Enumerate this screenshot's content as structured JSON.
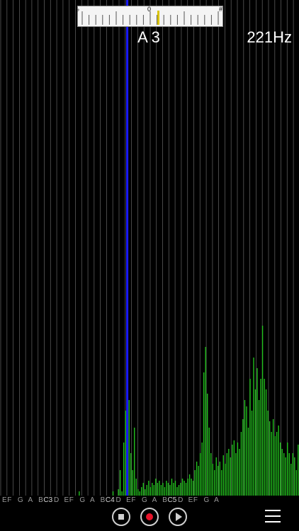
{
  "tuner": {
    "flat_symbol": "♭",
    "zero_label": "0",
    "sharp_symbol": "#",
    "needle_cents": 6,
    "needle_color": "#d9c300",
    "tick_count": 21
  },
  "reading": {
    "note": "A 3",
    "frequency": "221Hz"
  },
  "spectrum": {
    "bar_color": "#22c21d",
    "marker_color": "#1a1aff",
    "grid_color": "#5a5a5a",
    "bin_count": 168,
    "marker_bin": 71,
    "levels": [
      0.0,
      0.0,
      0.0,
      0.0,
      0.0,
      0.0,
      0.0,
      0.0,
      0.0,
      0.0,
      0.0,
      0.0,
      0.0,
      0.0,
      0.0,
      0.0,
      0.0,
      0.0,
      0.0,
      0.0,
      0.0,
      0.0,
      0.0,
      0.0,
      0.0,
      0.0,
      0.0,
      0.0,
      0.0,
      0.0,
      0.0,
      0.0,
      0.0,
      0.0,
      0.0,
      0.0,
      0.0,
      0.0,
      0.0,
      0.0,
      0.0,
      0.0,
      0.0,
      0.0,
      0.02,
      0.0,
      0.0,
      0.0,
      0.0,
      0.0,
      0.0,
      0.0,
      0.0,
      0.0,
      0.0,
      0.0,
      0.0,
      0.0,
      0.0,
      0.0,
      0.0,
      0.0,
      0.0,
      0.02,
      0.0,
      0.0,
      0.03,
      0.12,
      0.02,
      0.25,
      0.4,
      0.5,
      0.45,
      0.2,
      0.12,
      0.32,
      0.08,
      0.03,
      0.02,
      0.04,
      0.06,
      0.03,
      0.05,
      0.07,
      0.04,
      0.06,
      0.05,
      0.08,
      0.06,
      0.07,
      0.05,
      0.06,
      0.04,
      0.07,
      0.06,
      0.05,
      0.08,
      0.06,
      0.07,
      0.04,
      0.05,
      0.06,
      0.08,
      0.07,
      0.06,
      0.08,
      0.1,
      0.08,
      0.07,
      0.12,
      0.16,
      0.14,
      0.2,
      0.25,
      0.58,
      0.7,
      0.48,
      0.32,
      0.2,
      0.15,
      0.12,
      0.18,
      0.14,
      0.16,
      0.12,
      0.19,
      0.15,
      0.2,
      0.22,
      0.18,
      0.24,
      0.26,
      0.2,
      0.25,
      0.22,
      0.3,
      0.36,
      0.45,
      0.42,
      0.32,
      0.55,
      0.4,
      0.65,
      0.5,
      0.6,
      0.45,
      0.55,
      0.8,
      0.55,
      0.5,
      0.4,
      0.35,
      0.3,
      0.36,
      0.28,
      0.3,
      0.33,
      0.25,
      0.22,
      0.2,
      0.18,
      0.25,
      0.2,
      0.15,
      0.2,
      0.18,
      0.12,
      0.24,
      0.15,
      0.22
    ],
    "extra_peak_level": 0.36
  },
  "axis": {
    "labels": [
      "E",
      "F",
      "G",
      "A",
      "B",
      "C3",
      "D",
      "E",
      "F",
      "G",
      "A",
      "B",
      "C4",
      "D",
      "E",
      "F",
      "G",
      "A",
      "B",
      "C5",
      "D",
      "E",
      "F",
      "G",
      "A"
    ]
  },
  "controls": {
    "stop_label": "stop",
    "record_label": "record",
    "play_label": "play",
    "menu_label": "menu"
  }
}
